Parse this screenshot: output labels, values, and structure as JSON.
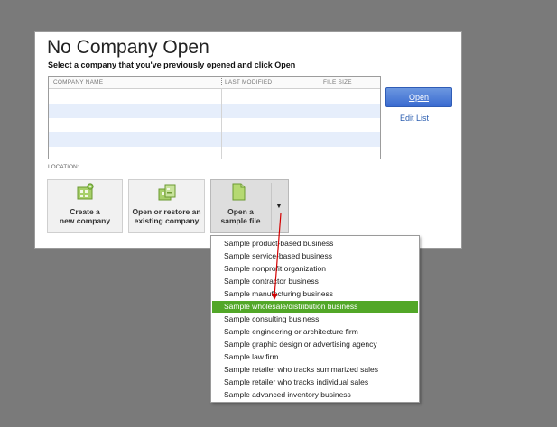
{
  "dialog": {
    "title": "No Company Open",
    "subtitle": "Select a company that you've previously opened and click Open",
    "table": {
      "columns": [
        "COMPANY NAME",
        "LAST MODIFIED",
        "FILE SIZE"
      ],
      "rows": []
    },
    "open_label": "Open",
    "edit_list_label": "Edit List",
    "location_label": "LOCATION:",
    "tiles": [
      {
        "line1": "Create a",
        "line2": "new company",
        "icon": "new-company-icon"
      },
      {
        "line1": "Open or restore an",
        "line2": "existing company",
        "icon": "open-restore-icon"
      },
      {
        "line1": "Open a",
        "line2": "sample file",
        "icon": "sample-file-icon"
      }
    ],
    "dropdown_arrow": "▼"
  },
  "sample_menu": {
    "items": [
      "Sample product-based business",
      "Sample service-based business",
      "Sample nonprofit organization",
      "Sample contractor business",
      "Sample manufacturing business",
      "Sample wholesale/distribution business",
      "Sample consulting business",
      "Sample engineering or architecture firm",
      "Sample graphic design or advertising agency",
      "Sample law firm",
      "Sample retailer who tracks summarized sales",
      "Sample retailer who tracks individual sales",
      "Sample advanced inventory business"
    ],
    "selected_index": 5
  },
  "colors": {
    "background": "#7a7a7a",
    "accent_blue": "#3a6bd0",
    "selection_green": "#52a728",
    "annotation_red": "#d40000"
  }
}
